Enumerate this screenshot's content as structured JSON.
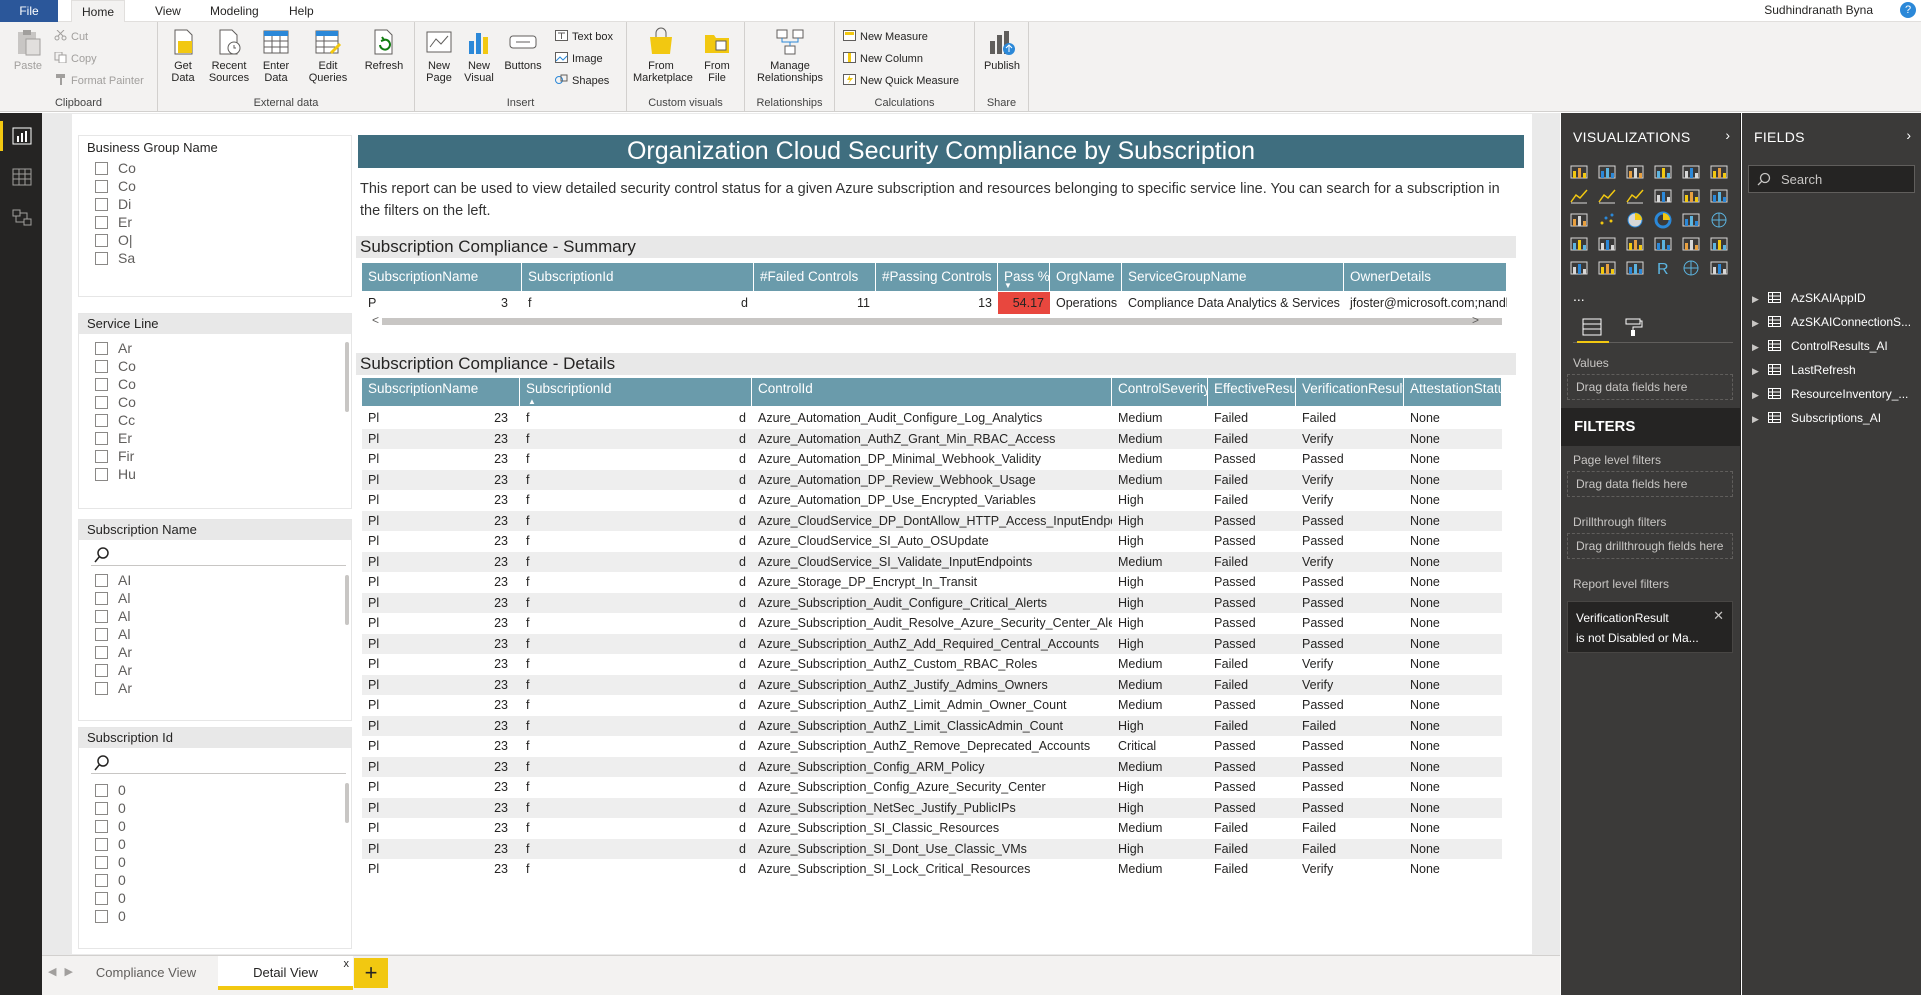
{
  "menu": {
    "file": "File",
    "home": "Home",
    "view": "View",
    "modeling": "Modeling",
    "help": "Help",
    "user": "Sudhindranath Byna",
    "help_icon": "?"
  },
  "ribbon": {
    "clipboard": {
      "paste": "Paste",
      "cut": "Cut",
      "copy": "Copy",
      "format_painter": "Format Painter",
      "label": "Clipboard"
    },
    "external": {
      "get_data": "Get Data",
      "recent_sources": "Recent Sources",
      "enter_data": "Enter Data",
      "edit_queries": "Edit Queries",
      "refresh": "Refresh",
      "label": "External data"
    },
    "insert": {
      "new_page": "New Page",
      "new_visual": "New Visual",
      "buttons": "Buttons",
      "text_box": "Text box",
      "image": "Image",
      "shapes": "Shapes",
      "label": "Insert"
    },
    "custom": {
      "from_marketplace": "From Marketplace",
      "from_file": "From File",
      "label": "Custom visuals"
    },
    "relationships": {
      "manage": "Manage Relationships",
      "label": "Relationships"
    },
    "calculations": {
      "new_measure": "New Measure",
      "new_column": "New Column",
      "new_quick_measure": "New Quick Measure",
      "label": "Calculations"
    },
    "share": {
      "publish": "Publish",
      "label": "Share"
    }
  },
  "slicers": {
    "business_group": {
      "title": "Business Group Name",
      "items": [
        "Co",
        "Co",
        "Di",
        "Er",
        "O|",
        "Sa"
      ]
    },
    "service_line": {
      "title": "Service Line",
      "items": [
        "Ar",
        "Co",
        "Co",
        "Co",
        "Cc",
        "Er",
        "Fir",
        "Hu"
      ]
    },
    "subscription_name": {
      "title": "Subscription Name",
      "items": [
        "AI",
        "Al",
        "Al",
        "Al",
        "Ar",
        "Ar",
        "Ar"
      ]
    },
    "subscription_id": {
      "title": "Subscription Id",
      "items": [
        "0",
        "0",
        "0",
        "0",
        "0",
        "0",
        "0",
        "0"
      ]
    }
  },
  "report": {
    "title": "Organization Cloud Security Compliance by Subscription",
    "description": "This report can be used to view detailed security control status for a given Azure subscription and resources belonging to specific service line. You can search for a subscription in the filters on the left."
  },
  "summary": {
    "title": "Subscription Compliance - Summary",
    "headers": [
      "SubscriptionName",
      "SubscriptionId",
      "#Failed Controls",
      "#Passing Controls",
      "Pass %",
      "OrgName",
      "ServiceGroupName",
      "OwnerDetails"
    ],
    "row": [
      "P",
      "3",
      "f",
      "d",
      "11",
      "13",
      "54.17",
      "Operations",
      "Compliance Data Analytics & Services",
      "jfoster@microsoft.com;nandk@mi"
    ],
    "pass_color": "#e8473e"
  },
  "details": {
    "title": "Subscription Compliance - Details",
    "headers": [
      "SubscriptionName",
      "SubscriptionId",
      "ControlId",
      "ControlSeverity",
      "EffectiveResult",
      "VerificationResult",
      "AttestationStatus"
    ],
    "rows": [
      [
        "Pl",
        "23",
        "f",
        "d",
        "Azure_Automation_Audit_Configure_Log_Analytics",
        "Medium",
        "Failed",
        "Failed",
        "None"
      ],
      [
        "Pl",
        "23",
        "f",
        "d",
        "Azure_Automation_AuthZ_Grant_Min_RBAC_Access",
        "Medium",
        "Failed",
        "Verify",
        "None"
      ],
      [
        "Pl",
        "23",
        "f",
        "d",
        "Azure_Automation_DP_Minimal_Webhook_Validity",
        "Medium",
        "Passed",
        "Passed",
        "None"
      ],
      [
        "Pl",
        "23",
        "f",
        "d",
        "Azure_Automation_DP_Review_Webhook_Usage",
        "Medium",
        "Failed",
        "Verify",
        "None"
      ],
      [
        "Pl",
        "23",
        "f",
        "d",
        "Azure_Automation_DP_Use_Encrypted_Variables",
        "High",
        "Failed",
        "Verify",
        "None"
      ],
      [
        "Pl",
        "23",
        "f",
        "d",
        "Azure_CloudService_DP_DontAllow_HTTP_Access_InputEndpoints",
        "High",
        "Passed",
        "Passed",
        "None"
      ],
      [
        "Pl",
        "23",
        "f",
        "d",
        "Azure_CloudService_SI_Auto_OSUpdate",
        "High",
        "Passed",
        "Passed",
        "None"
      ],
      [
        "Pl",
        "23",
        "f",
        "d",
        "Azure_CloudService_SI_Validate_InputEndpoints",
        "Medium",
        "Failed",
        "Verify",
        "None"
      ],
      [
        "Pl",
        "23",
        "f",
        "d",
        "Azure_Storage_DP_Encrypt_In_Transit",
        "High",
        "Passed",
        "Passed",
        "None"
      ],
      [
        "Pl",
        "23",
        "f",
        "d",
        "Azure_Subscription_Audit_Configure_Critical_Alerts",
        "High",
        "Passed",
        "Passed",
        "None"
      ],
      [
        "Pl",
        "23",
        "f",
        "d",
        "Azure_Subscription_Audit_Resolve_Azure_Security_Center_Alerts",
        "High",
        "Passed",
        "Passed",
        "None"
      ],
      [
        "Pl",
        "23",
        "f",
        "d",
        "Azure_Subscription_AuthZ_Add_Required_Central_Accounts",
        "High",
        "Passed",
        "Passed",
        "None"
      ],
      [
        "Pl",
        "23",
        "f",
        "d",
        "Azure_Subscription_AuthZ_Custom_RBAC_Roles",
        "Medium",
        "Failed",
        "Verify",
        "None"
      ],
      [
        "Pl",
        "23",
        "f",
        "d",
        "Azure_Subscription_AuthZ_Justify_Admins_Owners",
        "Medium",
        "Failed",
        "Verify",
        "None"
      ],
      [
        "Pl",
        "23",
        "f",
        "d",
        "Azure_Subscription_AuthZ_Limit_Admin_Owner_Count",
        "Medium",
        "Passed",
        "Passed",
        "None"
      ],
      [
        "Pl",
        "23",
        "f",
        "d",
        "Azure_Subscription_AuthZ_Limit_ClassicAdmin_Count",
        "High",
        "Failed",
        "Failed",
        "None"
      ],
      [
        "Pl",
        "23",
        "f",
        "d",
        "Azure_Subscription_AuthZ_Remove_Deprecated_Accounts",
        "Critical",
        "Passed",
        "Passed",
        "None"
      ],
      [
        "Pl",
        "23",
        "f",
        "d",
        "Azure_Subscription_Config_ARM_Policy",
        "Medium",
        "Passed",
        "Passed",
        "None"
      ],
      [
        "Pl",
        "23",
        "f",
        "d",
        "Azure_Subscription_Config_Azure_Security_Center",
        "High",
        "Passed",
        "Passed",
        "None"
      ],
      [
        "Pl",
        "23",
        "f",
        "d",
        "Azure_Subscription_NetSec_Justify_PublicIPs",
        "High",
        "Passed",
        "Passed",
        "None"
      ],
      [
        "Pl",
        "23",
        "f",
        "d",
        "Azure_Subscription_SI_Classic_Resources",
        "Medium",
        "Failed",
        "Failed",
        "None"
      ],
      [
        "Pl",
        "23",
        "f",
        "d",
        "Azure_Subscription_SI_Dont_Use_Classic_VMs",
        "High",
        "Failed",
        "Failed",
        "None"
      ],
      [
        "Pl",
        "23",
        "f",
        "d",
        "Azure_Subscription_SI_Lock_Critical_Resources",
        "Medium",
        "Failed",
        "Verify",
        "None"
      ]
    ]
  },
  "pages": {
    "compliance_view": "Compliance View",
    "detail_view": "Detail View",
    "close": "x",
    "add": "+"
  },
  "viz_pane": {
    "title": "VISUALIZATIONS",
    "more": "...",
    "values_label": "Values",
    "drag_fields": "Drag data fields here",
    "filters_title": "FILTERS",
    "page_filters": "Page level filters",
    "page_drag": "Drag data fields here",
    "drillthrough": "Drillthrough filters",
    "drill_drag": "Drag drillthrough fields here",
    "report_filters": "Report level filters",
    "filter_card_line1": "VerificationResult",
    "filter_card_line2": "is not Disabled or Ma..."
  },
  "fields_pane": {
    "title": "FIELDS",
    "search_placeholder": "Search",
    "items": [
      "AzSKAIAppID",
      "AzSKAIConnectionS...",
      "ControlResults_AI",
      "LastRefresh",
      "ResourceInventory_...",
      "Subscriptions_AI"
    ]
  }
}
